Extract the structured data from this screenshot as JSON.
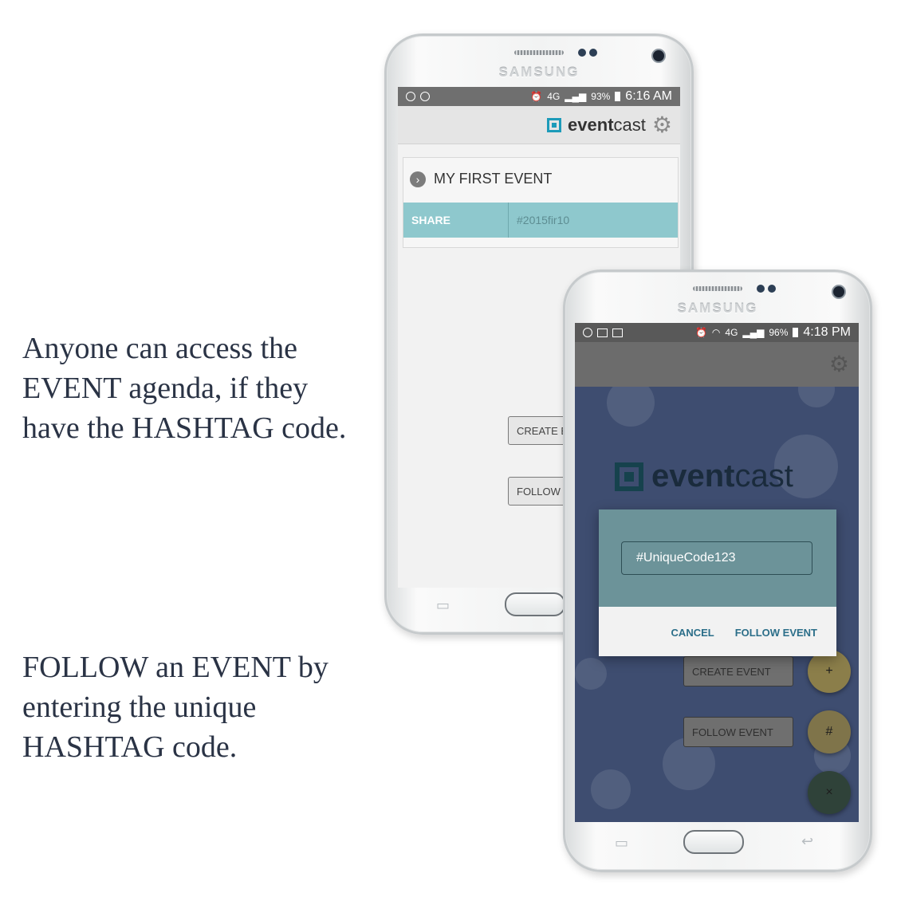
{
  "captions": {
    "access": "Anyone can access the EVENT agenda, if they have the HASHTAG code.",
    "follow": "FOLLOW an EVENT by entering the unique HASHTAG code."
  },
  "device_brand": "SAMSUNG",
  "back_phone": {
    "status": {
      "network": "4G",
      "battery": "93%",
      "time": "6:16 AM"
    },
    "app": {
      "logo_bold": "event",
      "logo_light": "cast"
    },
    "event": {
      "title": "MY FIRST EVENT",
      "share_label": "SHARE",
      "share_code": "#2015fir10"
    },
    "buttons": {
      "create": "CREATE EVENT",
      "follow": "FOLLOW EVENT"
    }
  },
  "front_phone": {
    "status": {
      "network": "4G",
      "battery": "96%",
      "time": "4:18 PM"
    },
    "app": {
      "logo_bold": "event",
      "logo_light": "cast"
    },
    "dialog": {
      "input_value": "#UniqueCode123",
      "cancel": "CANCEL",
      "confirm": "FOLLOW EVENT"
    },
    "menu": {
      "create": "CREATE EVENT",
      "follow": "FOLLOW EVENT"
    },
    "fabs": {
      "add": "+",
      "hashtag": "#",
      "close": "×"
    }
  },
  "colors": {
    "accent": "#1d9bb9",
    "share_row": "#8ec8cd",
    "dialog_header": "#6c9399",
    "fab_add": "#8b7e4a",
    "fab_hash": "#7f744a",
    "fab_close": "#2f4239"
  }
}
